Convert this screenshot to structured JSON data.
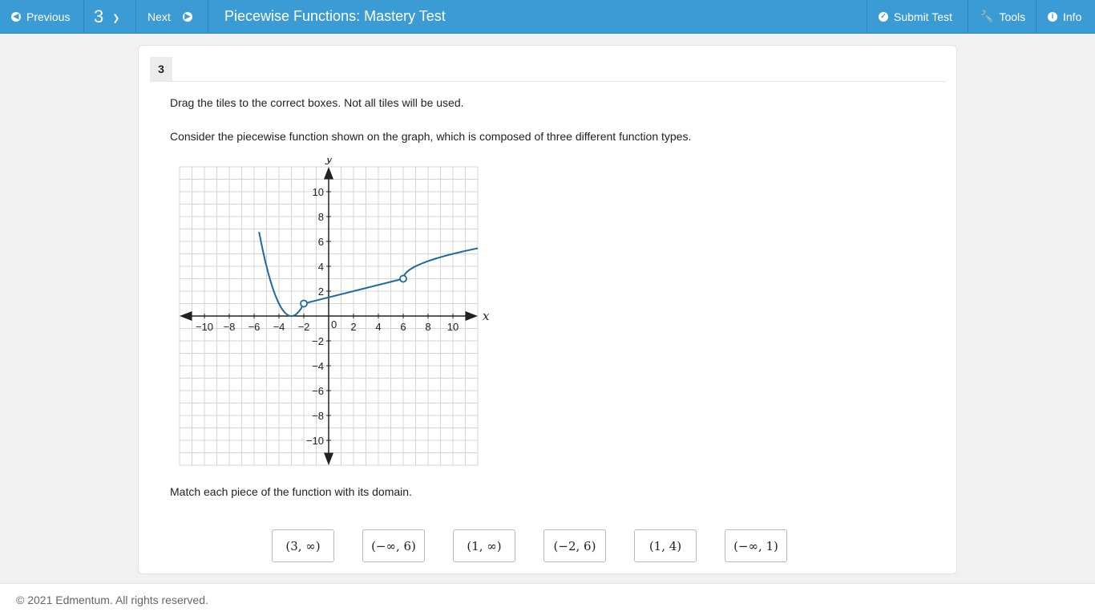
{
  "topbar": {
    "previous_label": "Previous",
    "question_number": "3",
    "next_label": "Next",
    "title": "Piecewise Functions: Mastery Test",
    "submit_label": "Submit Test",
    "tools_label": "Tools",
    "info_label": "Info",
    "bar_color": "#3a9bd5"
  },
  "question": {
    "number": "3",
    "instruction": "Drag the tiles to the correct boxes. Not all tiles will be used.",
    "description": "Consider the piecewise function shown on the graph, which is composed of three different function types.",
    "prompt": "Match each piece of the function with its domain."
  },
  "graph": {
    "x_axis_label": "x",
    "y_axis_label": "y",
    "origin_label": "0",
    "x_ticks": [
      "-10",
      "-8",
      "-6",
      "-4",
      "-2",
      "2",
      "4",
      "6",
      "8",
      "10"
    ],
    "y_ticks": [
      "10",
      "8",
      "6",
      "4",
      "2",
      "-2",
      "-4",
      "-6",
      "-8",
      "-10"
    ],
    "curve_color": "#1f6a9a",
    "open_points": [
      [
        -2,
        1
      ],
      [
        6,
        3
      ]
    ]
  },
  "tiles": [
    "(3, ∞)",
    "(−∞, 6)",
    "(1, ∞)",
    "(−2, 6)",
    "(1, 4)",
    "(−∞, 1)"
  ],
  "footer": {
    "copyright": "© 2021 Edmentum. All rights reserved."
  }
}
